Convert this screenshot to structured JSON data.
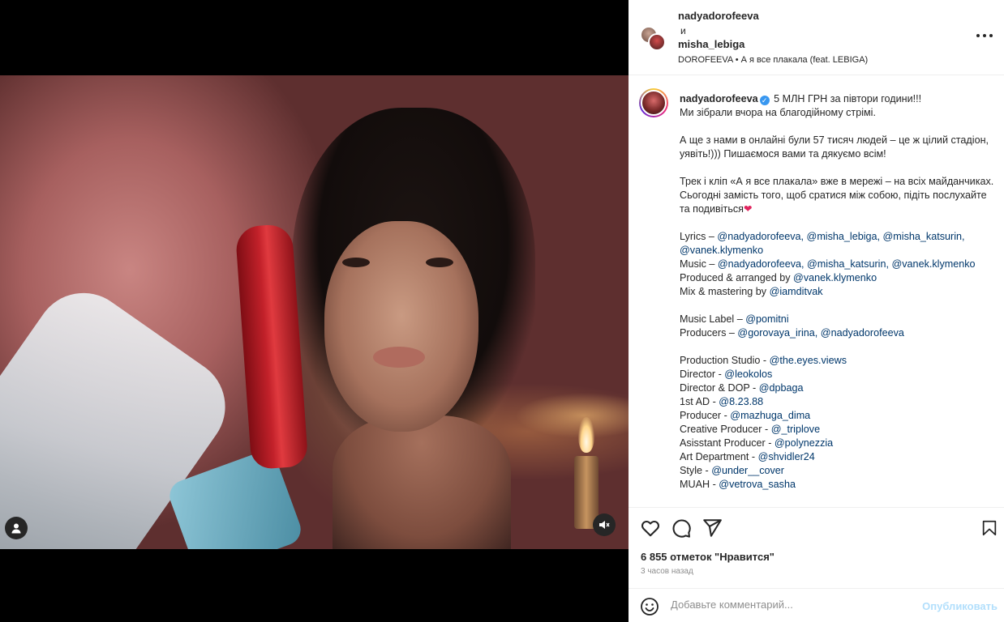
{
  "header": {
    "user1": "nadyadorofeeva",
    "and_word": "и",
    "user2": "misha_lebiga",
    "audio": "DOROFEEVA • А я все плакала (feat. LEBIGA)"
  },
  "caption": {
    "username": "nadyadorofeeva",
    "first_line": " 5 МЛН ГРН за півтори години!!!",
    "line2": "Ми зібрали вчора на благодійному стрімі.",
    "para2": "А ще з нами в онлайні були 57 тисяч людей – це ж цілий стадіон, уявіть!))) Пишаємося вами та дякуємо всім!",
    "para3_a": "Трек і кліп «А я все плакала» вже в мережі – на всіх майданчиках.",
    "para3_b": "Сьогодні замість того, щоб сратися між собою, підіть послухайте та подивіться",
    "heart": "❤",
    "credits_block1": [
      {
        "label": "Lyrics – ",
        "mentions": "@nadyadorofeeva, @misha_lebiga, @misha_katsurin, @vanek.klymenko"
      },
      {
        "label": "Music – ",
        "mentions": "@nadyadorofeeva, @misha_katsurin, @vanek.klymenko"
      },
      {
        "label": "Produced & arranged by ",
        "mentions": "@vanek.klymenko"
      },
      {
        "label": "Mix & mastering by ",
        "mentions": "@iamditvak"
      }
    ],
    "credits_block2": [
      {
        "label": "Music Label – ",
        "mentions": "@pomitni"
      },
      {
        "label": "Producers – ",
        "mentions": "@gorovaya_irina, @nadyadorofeeva"
      }
    ],
    "credits_block3": [
      {
        "label": "Production Studio - ",
        "mentions": "@the.eyes.views"
      },
      {
        "label": "Director - ",
        "mentions": "@leokolos"
      },
      {
        "label": "Director & DOP - ",
        "mentions": "@dpbaga"
      },
      {
        "label": "1st AD - ",
        "mentions": "@8.23.88"
      },
      {
        "label": "Producer - ",
        "mentions": "@mazhuga_dima"
      },
      {
        "label": "Creative Producer - ",
        "mentions": "@_triplove"
      },
      {
        "label": "Asisstant Producer - ",
        "mentions": "@polynezzia"
      },
      {
        "label": "Art Department - ",
        "mentions": "@shvidler24"
      },
      {
        "label": "Style - ",
        "mentions": "@under__cover"
      },
      {
        "label": "MUAH - ",
        "mentions": "@vetrova_sasha"
      }
    ]
  },
  "likes": "6 855 отметок \"Нравится\"",
  "time": "3 часов назад",
  "comment": {
    "placeholder": "Добавьте комментарий...",
    "publish": "Опубликовать"
  },
  "icons": {
    "like": "heart-icon",
    "comment": "comment-icon",
    "share": "share-icon",
    "save": "bookmark-icon",
    "emoji": "emoji-icon",
    "user_tag": "user-icon",
    "mute": "muted-speaker-icon",
    "more": "more-options-icon",
    "verified": "verified-badge-icon"
  },
  "colors": {
    "mention": "#00376b",
    "publish_disabled": "#b2dffc",
    "verified": "#3897f0"
  }
}
